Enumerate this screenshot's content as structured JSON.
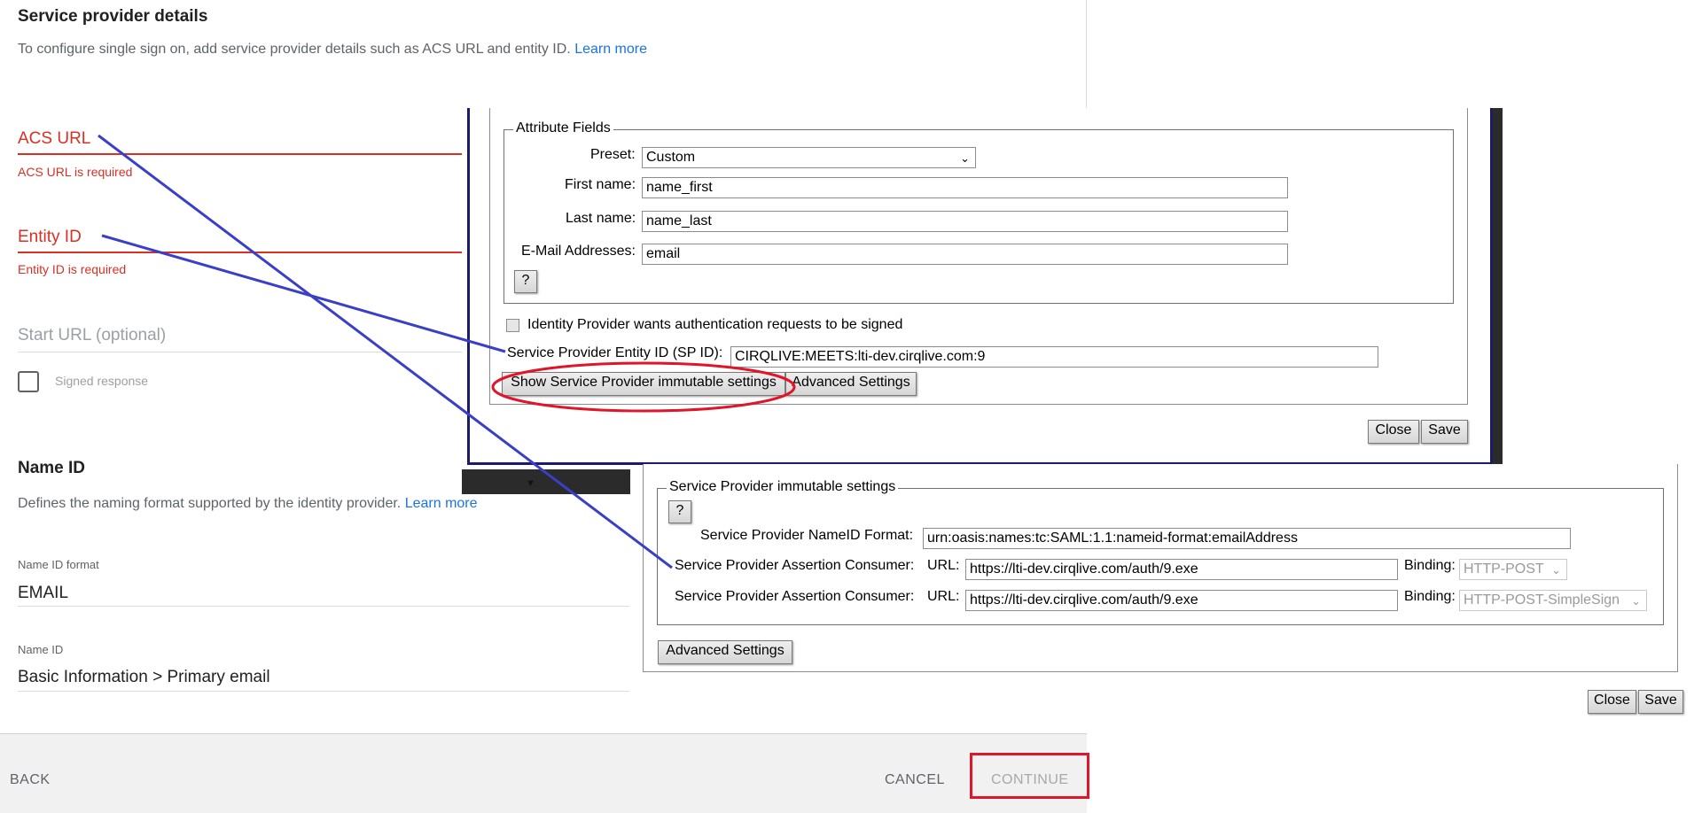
{
  "admin": {
    "section_title": "Service provider details",
    "section_desc": "To configure single sign on, add service provider details such as ACS URL and entity ID.",
    "learn_more": "Learn more",
    "acs_label": "ACS URL",
    "acs_error": "ACS URL is required",
    "entity_label": "Entity ID",
    "entity_error": "Entity ID is required",
    "start_url_placeholder": "Start URL (optional)",
    "signed_response_label": "Signed response",
    "name_id_title": "Name ID",
    "name_id_desc": "Defines the naming format supported by the identity provider.",
    "name_id_learn_more": "Learn more",
    "name_id_format_label": "Name ID format",
    "name_id_format_value": "EMAIL",
    "name_id_label": "Name ID",
    "name_id_value": "Basic Information > Primary email"
  },
  "footer": {
    "back": "BACK",
    "cancel": "CANCEL",
    "continue": "CONTINUE"
  },
  "dialog1": {
    "attribute_fields_legend": "Attribute Fields",
    "preset_label": "Preset:",
    "preset_value": "Custom",
    "first_name_label": "First name:",
    "first_name_value": "name_first",
    "last_name_label": "Last name:",
    "last_name_value": "name_last",
    "email_label": "E-Mail Addresses:",
    "email_value": "email",
    "help_button": "?",
    "idp_signed_label": "Identity Provider wants authentication requests to be signed",
    "sp_entity_label": "Service Provider Entity ID (SP ID):",
    "sp_entity_value": "CIRQLIVE:MEETS:lti-dev.cirqlive.com:9",
    "show_immutable_button": "Show Service Provider immutable settings",
    "advanced_settings_button": "Advanced Settings",
    "close_button": "Close",
    "save_button": "Save"
  },
  "dialog2": {
    "legend": "Service Provider immutable settings",
    "help_button": "?",
    "nameid_format_label": "Service Provider NameID Format:",
    "nameid_format_value": "urn:oasis:names:tc:SAML:1.1:nameid-format:emailAddress",
    "acs_rows": [
      {
        "label": "Service Provider Assertion Consumer:",
        "url_label": "URL:",
        "url_value": "https://lti-dev.cirqlive.com/auth/9.exe",
        "binding_label": "Binding:",
        "binding_value": "HTTP-POST"
      },
      {
        "label": "Service Provider Assertion Consumer:",
        "url_label": "URL:",
        "url_value": "https://lti-dev.cirqlive.com/auth/9.exe",
        "binding_label": "Binding:",
        "binding_value": "HTTP-POST-SimpleSign"
      }
    ],
    "advanced_settings_button": "Advanced Settings",
    "close_button": "Close",
    "save_button": "Save"
  },
  "annotations": {
    "line_color": "#3a3fc8",
    "highlight_color": "#e0152a"
  }
}
